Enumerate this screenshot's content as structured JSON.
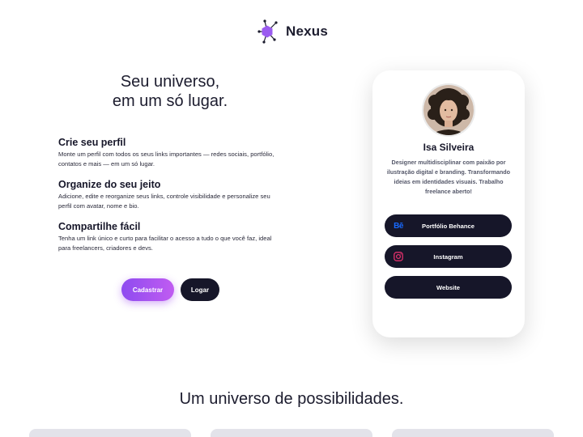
{
  "brand": {
    "name": "Nexus",
    "logo_icon": "hexagon-network-icon",
    "accent": "#9b5cf0"
  },
  "hero": {
    "title_line1": "Seu universo,",
    "title_line2": "em um só lugar."
  },
  "features": [
    {
      "title": "Crie seu perfil",
      "text": "Monte um perfil com todos os seus links importantes — redes sociais, portfólio, contatos e mais — em um só lugar."
    },
    {
      "title": "Organize do seu jeito",
      "text": "Adicione, edite e reorganize seus links, controle visibilidade e personalize seu perfil com avatar, nome e bio."
    },
    {
      "title": "Compartilhe fácil",
      "text": "Tenha um link único e curto para facilitar o acesso a tudo o que você faz, ideal para freelancers, criadores e devs."
    }
  ],
  "cta": {
    "signup_label": "Cadastrar",
    "login_label": "Logar"
  },
  "profile": {
    "name": "Isa Silveira",
    "bio": "Designer multidisciplinar com paixão por ilustração digital e branding. Transformando ideias em identidades visuais. Trabalho freelance aberto!",
    "links": [
      {
        "label": "Portfólio Behance",
        "icon": "behance-icon"
      },
      {
        "label": "Instagram",
        "icon": "instagram-icon"
      },
      {
        "label": "Website",
        "icon": ""
      }
    ]
  },
  "section": {
    "title": "Um universo de possibilidades."
  },
  "colors": {
    "dark": "#161629",
    "gradient_start": "#8e4bf0",
    "gradient_end": "#c05cf1",
    "behance": "#1769ff",
    "instagram": "#e1306c"
  }
}
